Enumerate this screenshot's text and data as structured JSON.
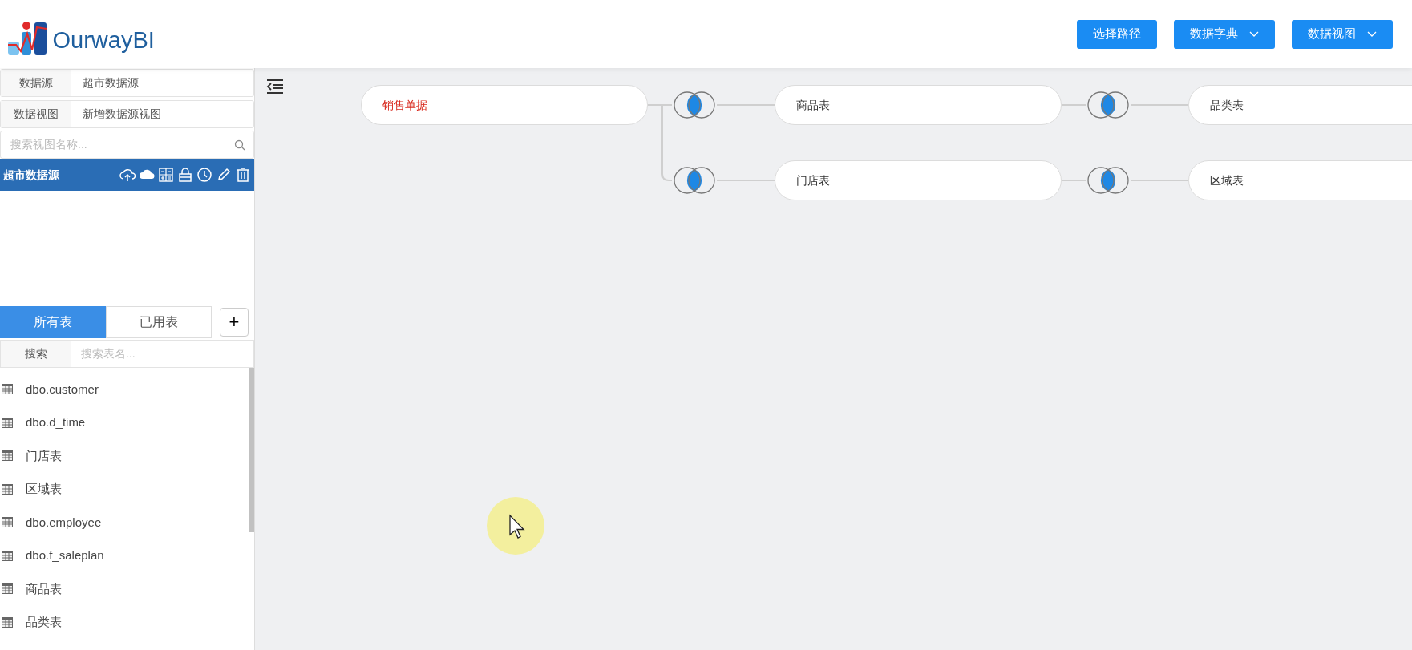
{
  "header": {
    "logo_text": "OurwayBI",
    "buttons": [
      {
        "label": "选择路径",
        "dropdown": false
      },
      {
        "label": "数据字典",
        "dropdown": true
      },
      {
        "label": "数据视图",
        "dropdown": true
      }
    ]
  },
  "sidebar": {
    "fields": [
      {
        "label": "数据源",
        "value": "超市数据源"
      },
      {
        "label": "数据视图",
        "value": "新增数据源视图"
      }
    ],
    "view_search": {
      "placeholder": "搜索视图名称..."
    },
    "views": [
      {
        "label": "超市数据源",
        "selected": true
      }
    ],
    "tabs": [
      {
        "label": "所有表",
        "selected": true
      },
      {
        "label": "已用表",
        "selected": false
      }
    ],
    "add_button": "+",
    "table_search": {
      "label": "搜索",
      "placeholder": "搜索表名..."
    },
    "tables": [
      {
        "label": "dbo.customer"
      },
      {
        "label": "dbo.d_time"
      },
      {
        "label": "门店表"
      },
      {
        "label": "区域表"
      },
      {
        "label": "dbo.employee"
      },
      {
        "label": "dbo.f_saleplan"
      },
      {
        "label": "商品表"
      },
      {
        "label": "品类表"
      }
    ]
  },
  "diagram": {
    "root": {
      "label": "销售单据",
      "children": [
        {
          "label": "商品表",
          "children": [
            {
              "label": "品类表"
            }
          ]
        },
        {
          "label": "门店表",
          "children": [
            {
              "label": "区域表"
            }
          ]
        }
      ]
    }
  }
}
